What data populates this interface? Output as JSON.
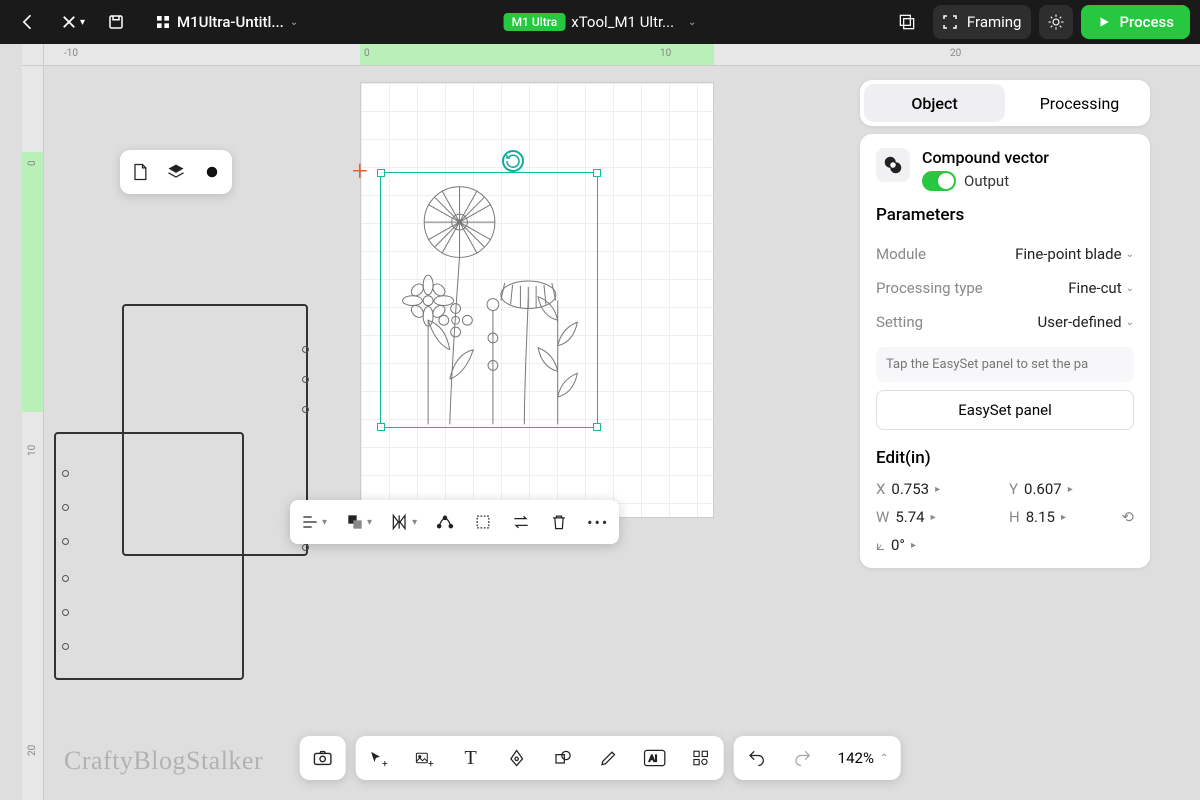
{
  "topbar": {
    "file_title": "M1Ultra-Untitl...",
    "device_chip": "M1 Ultra",
    "device_name": "xTool_M1 Ultr...",
    "framing": "Framing",
    "process": "Process"
  },
  "ruler": {
    "n10": "-10",
    "p0": "0",
    "p10": "10",
    "p20": "20",
    "v0": "0",
    "v10": "10",
    "v20": "20"
  },
  "tabs": {
    "object": "Object",
    "processing": "Processing"
  },
  "compound": {
    "title": "Compound vector",
    "output": "Output"
  },
  "params": {
    "heading": "Parameters",
    "module": {
      "k": "Module",
      "v": "Fine-point blade"
    },
    "ptype": {
      "k": "Processing type",
      "v": "Fine-cut"
    },
    "setting": {
      "k": "Setting",
      "v": "User-defined"
    },
    "note": "Tap the EasySet panel to set the pa",
    "easyset": "EasySet panel"
  },
  "edit": {
    "heading": "Edit(in)",
    "x": {
      "lab": "X",
      "val": "0.753"
    },
    "y": {
      "lab": "Y",
      "val": "0.607"
    },
    "w": {
      "lab": "W",
      "val": "5.74"
    },
    "h": {
      "lab": "H",
      "val": "8.15"
    },
    "r": {
      "lab": "⟀",
      "val": "0°"
    }
  },
  "zoom": "142%",
  "watermark": "CraftyBlogStalker"
}
